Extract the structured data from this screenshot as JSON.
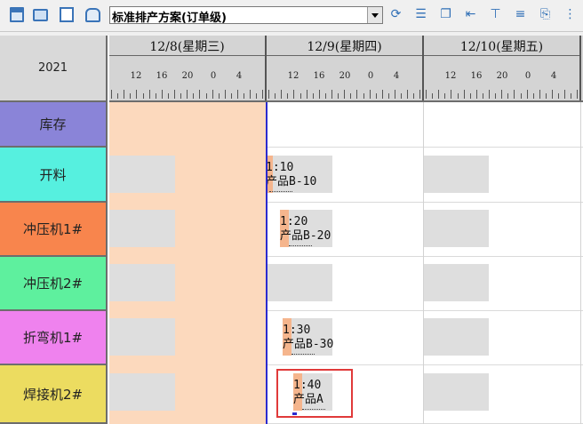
{
  "toolbar": {
    "icons": [
      "save-icon",
      "print-icon",
      "print-preview-icon",
      "print-setup-icon",
      "refresh-icon",
      "list-icon",
      "copy-icon",
      "indent-icon",
      "filter-icon",
      "align-icon",
      "export-icon",
      "more-icon"
    ],
    "scheme_value": "标准排产方案(订单级)"
  },
  "grid": {
    "year": "2021",
    "days": [
      {
        "label": "12/8(星期三)"
      },
      {
        "label": "12/9(星期四)"
      },
      {
        "label": "12/10(星期五)"
      }
    ],
    "hour_labels": [
      "12",
      "16",
      "20",
      "0",
      "4"
    ],
    "rows": [
      {
        "label": "库存",
        "color": "#8a84d8"
      },
      {
        "label": "开料",
        "color": "#56f0df"
      },
      {
        "label": "冲压机1#",
        "color": "#f8854d"
      },
      {
        "label": "冲压机2#",
        "color": "#5ef09e"
      },
      {
        "label": "折弯机1#",
        "color": "#ef82ee"
      },
      {
        "label": "焊接机2#",
        "color": "#ecdc60"
      }
    ],
    "tasks": [
      {
        "line1": "1:10",
        "line2": "产品B-10"
      },
      {
        "line1": "1:20",
        "line2": "产品B-20"
      },
      {
        "line1": "1:30",
        "line2": "产品B-30"
      },
      {
        "line1": "1:40",
        "line2": "产品A"
      }
    ],
    "colors": {
      "past_band": "#fcd9bd",
      "now_line": "#2b2bd0",
      "selection": "#e03a3a",
      "task_bar": "#f5b58d"
    }
  }
}
